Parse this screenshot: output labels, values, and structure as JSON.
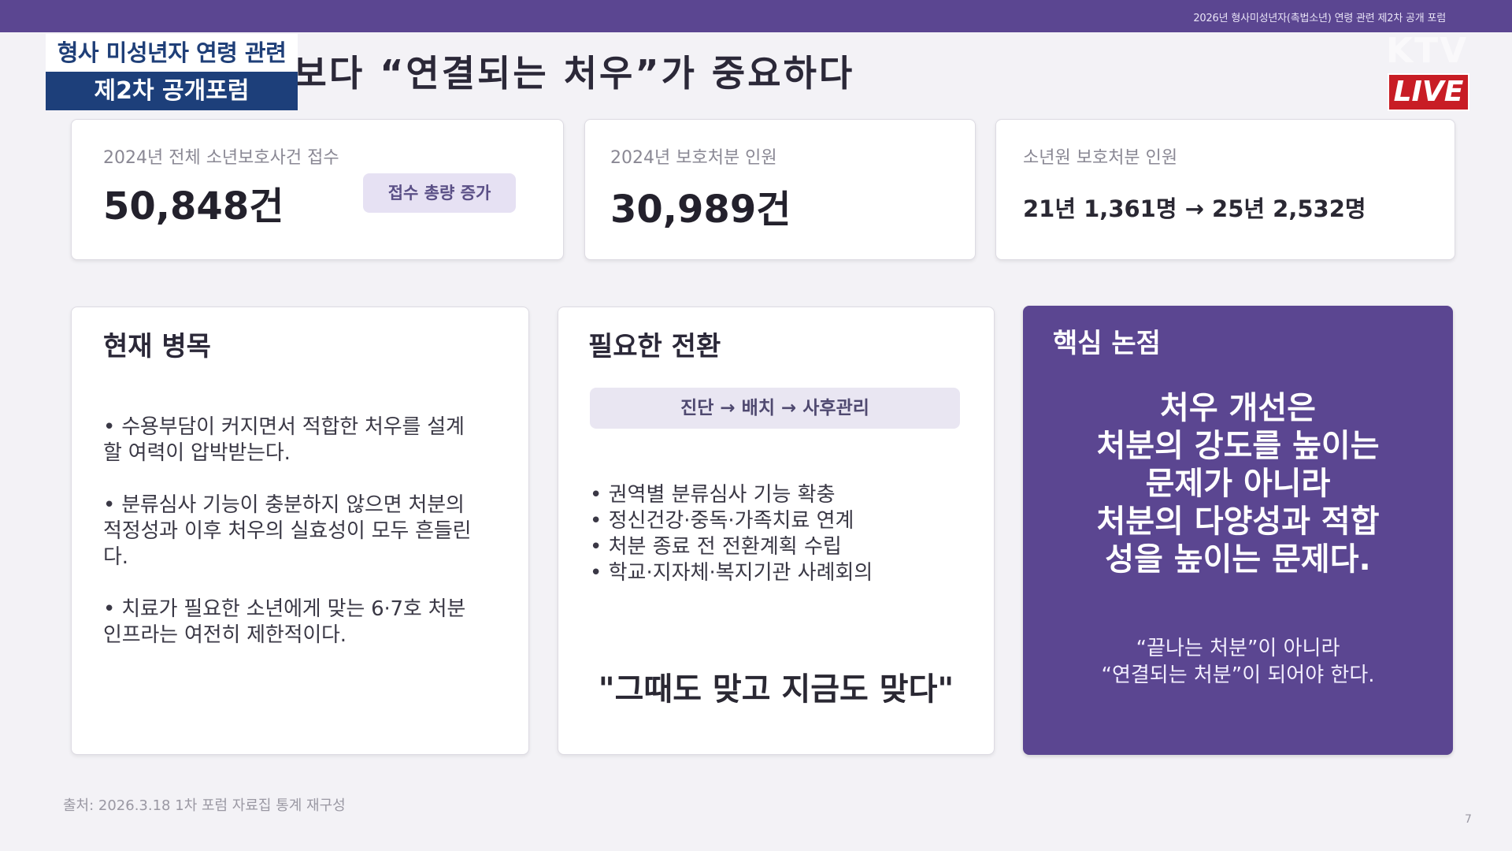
{
  "top_bar": {
    "text": "2026년 형사미성년자(촉법소년) 연령 관련 제2차 공개 포럼"
  },
  "slide_title": "몇 호 처분”보다 “연결되는 처우”가 중요하다",
  "broadcast": {
    "banner_line1": "형사 미성년자 연령 관련",
    "banner_line2": "제2차 공개포럼",
    "logo": "KTV",
    "live": "LIVE"
  },
  "stats": [
    {
      "label": "2024년 전체 소년보호사건 접수",
      "value": "50,848건",
      "tag": "접수 총량 증가"
    },
    {
      "label": "2024년 보호처분 인원",
      "value": "30,989건"
    },
    {
      "label": "소년원 보호처분 인원",
      "value": "21년 1,361명 → 25년 2,532명"
    }
  ],
  "panels": {
    "current": {
      "heading": "현재 병목",
      "bullets": [
        "• 수용부담이 커지면서 적합한 처우를 설계할 여력이 압박받는다.",
        "• 분류심사 기능이 충분하지 않으면 처분의 적정성과 이후 처우의 실효성이 모두 흔들린다.",
        "• 치료가 필요한 소년에게 맞는 6·7호 처분 인프라는 여전히 제한적이다."
      ]
    },
    "needed": {
      "heading": "필요한 전환",
      "flow": "진단 → 배치 → 사후관리",
      "items": [
        "• 권역별 분류심사 기능 확충",
        "• 정신건강·중독·가족치료 연계",
        "• 처분 종료 전 전환계획 수립",
        "• 학교·지자체·복지기관 사례회의"
      ],
      "quote": "\"그때도 맞고 지금도 맞다\""
    },
    "key": {
      "heading": "핵심 논점",
      "main_lines": [
        "처우 개선은",
        "처분의 강도를 높이는",
        "문제가 아니라",
        "처분의 다양성과 적합",
        "성을 높이는 문제다."
      ],
      "sub_lines": [
        "“끝나는 처분”이 아니라",
        "“연결되는 처분”이 되어야 한다."
      ]
    }
  },
  "source": "출처: 2026.3.18 1차 포럼 자료집 통계 재구성",
  "page_number": "7",
  "colors": {
    "accent": "#5b4691",
    "banner_blue": "#1d3f7a",
    "live_red": "#c81d25"
  }
}
